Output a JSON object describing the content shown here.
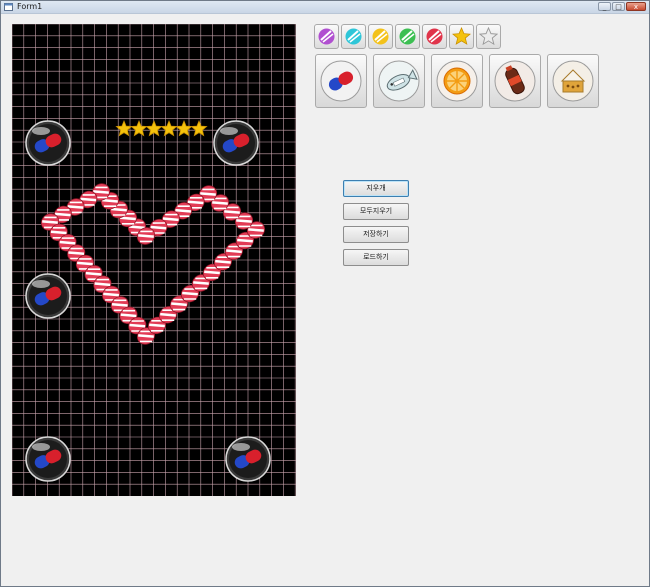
{
  "window": {
    "title": "Form1"
  },
  "window_buttons": {
    "minimize": "_",
    "maximize": "□",
    "close": "x"
  },
  "palette_small": [
    {
      "name": "candy-purple",
      "color": "#b04fd0"
    },
    {
      "name": "candy-cyan",
      "color": "#2ec6d8"
    },
    {
      "name": "candy-yellow",
      "color": "#f3c21a"
    },
    {
      "name": "candy-green",
      "color": "#3cbf52"
    },
    {
      "name": "candy-red",
      "color": "#e0344a"
    },
    {
      "name": "star-gold",
      "color": "#f4c20d"
    },
    {
      "name": "star-outline",
      "color": "#9a9a9a"
    }
  ],
  "palette_big": [
    {
      "name": "capsule-ball"
    },
    {
      "name": "fish-ball"
    },
    {
      "name": "orange-ball"
    },
    {
      "name": "cola-ball"
    },
    {
      "name": "cake-ball"
    }
  ],
  "actions": {
    "erase": "지우개",
    "clear_all": "모두지우기",
    "save": "저장하기",
    "load": "로드하기"
  },
  "canvas": {
    "grid_color": "#c9a3ad",
    "candy_color": "#e23b55",
    "star_color": "#f4c20d",
    "bubble_red": "#d8202c",
    "bubble_blue": "#2448c8"
  }
}
